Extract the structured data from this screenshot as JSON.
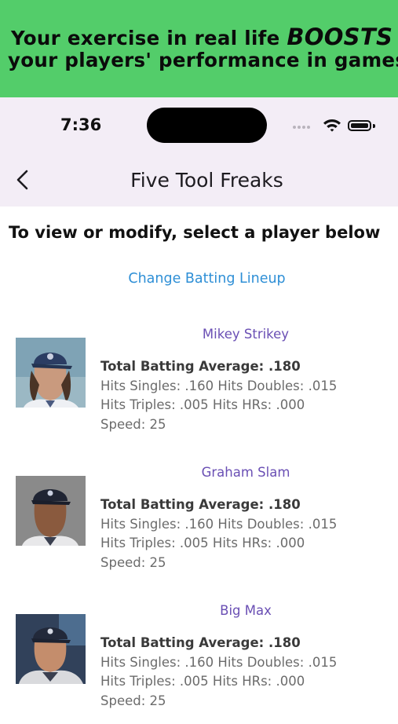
{
  "promo": {
    "line1_prefix": "Your exercise in real life ",
    "line1_emphasis": "BOOSTS",
    "line2": "your players' performance in games"
  },
  "status_bar": {
    "time": "7:36",
    "icons": [
      "signal-icon",
      "wifi-icon",
      "battery-icon"
    ]
  },
  "nav": {
    "back_icon": "chevron-left-icon",
    "title": "Five Tool Freaks"
  },
  "instructions": "To view or modify, select a player below",
  "lineup_link": "Change Batting Lineup",
  "colors": {
    "promo_bg": "#53cd6a",
    "header_bg": "#f3edf6",
    "link": "#2e8fd6",
    "player_name": "#6a4fb4"
  },
  "players": [
    {
      "name": "Mikey Strikey",
      "avatar_icon": "player-portrait",
      "avg": "Total Batting Average: .180",
      "line1": "Hits Singles: .160 Hits Doubles: .015",
      "line2": "Hits Triples: .005 Hits HRs: .000",
      "speed": "Speed: 25"
    },
    {
      "name": "Graham Slam",
      "avatar_icon": "player-portrait",
      "avg": "Total Batting Average: .180",
      "line1": "Hits Singles: .160 Hits Doubles: .015",
      "line2": "Hits Triples: .005 Hits HRs: .000",
      "speed": "Speed: 25"
    },
    {
      "name": "Big Max",
      "avatar_icon": "player-portrait",
      "avg": "Total Batting Average: .180",
      "line1": "Hits Singles: .160 Hits Doubles: .015",
      "line2": "Hits Triples: .005 Hits HRs: .000",
      "speed": "Speed: 25"
    }
  ]
}
